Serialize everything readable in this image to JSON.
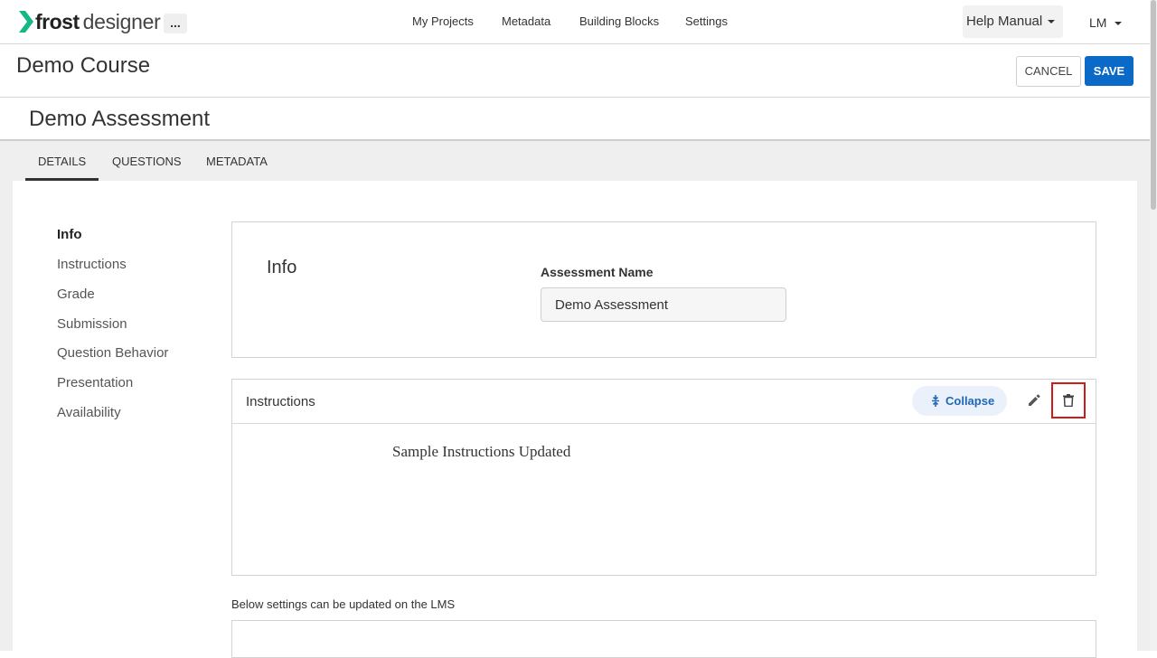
{
  "app": {
    "logo_bold": "frost",
    "logo_light": "designer",
    "more_label": "...",
    "nav": [
      "My Projects",
      "Metadata",
      "Building Blocks",
      "Settings"
    ],
    "help_label": "Help Manual",
    "user_initials": "LM"
  },
  "course": {
    "title": "Demo Course",
    "cancel_label": "CANCEL",
    "save_label": "SAVE"
  },
  "assessment": {
    "title": "Demo Assessment",
    "tabs": [
      {
        "label": "DETAILS",
        "active": true
      },
      {
        "label": "QUESTIONS",
        "active": false
      },
      {
        "label": "METADATA",
        "active": false
      }
    ]
  },
  "sidebar": {
    "items": [
      {
        "label": "Info",
        "active": true
      },
      {
        "label": "Instructions",
        "active": false
      },
      {
        "label": "Grade",
        "active": false
      },
      {
        "label": "Submission",
        "active": false
      },
      {
        "label": "Question Behavior",
        "active": false
      },
      {
        "label": "Presentation",
        "active": false
      },
      {
        "label": "Availability",
        "active": false
      }
    ]
  },
  "info_section": {
    "heading": "Info",
    "name_label": "Assessment Name",
    "name_value": "Demo Assessment"
  },
  "instructions_section": {
    "title": "Instructions",
    "collapse_label": "Collapse",
    "content": "Sample Instructions Updated"
  },
  "lms_note": "Below settings can be updated on the LMS",
  "icons": {
    "logo": "frost-chevron-logo",
    "collapse": "collapse-arrows-icon",
    "edit": "pencil-icon",
    "delete": "trash-icon",
    "dropdown": "caret-down-icon"
  },
  "colors": {
    "primary": "#0b69c7",
    "logo_accent": "#12b886",
    "highlight": "#d11a1a"
  }
}
